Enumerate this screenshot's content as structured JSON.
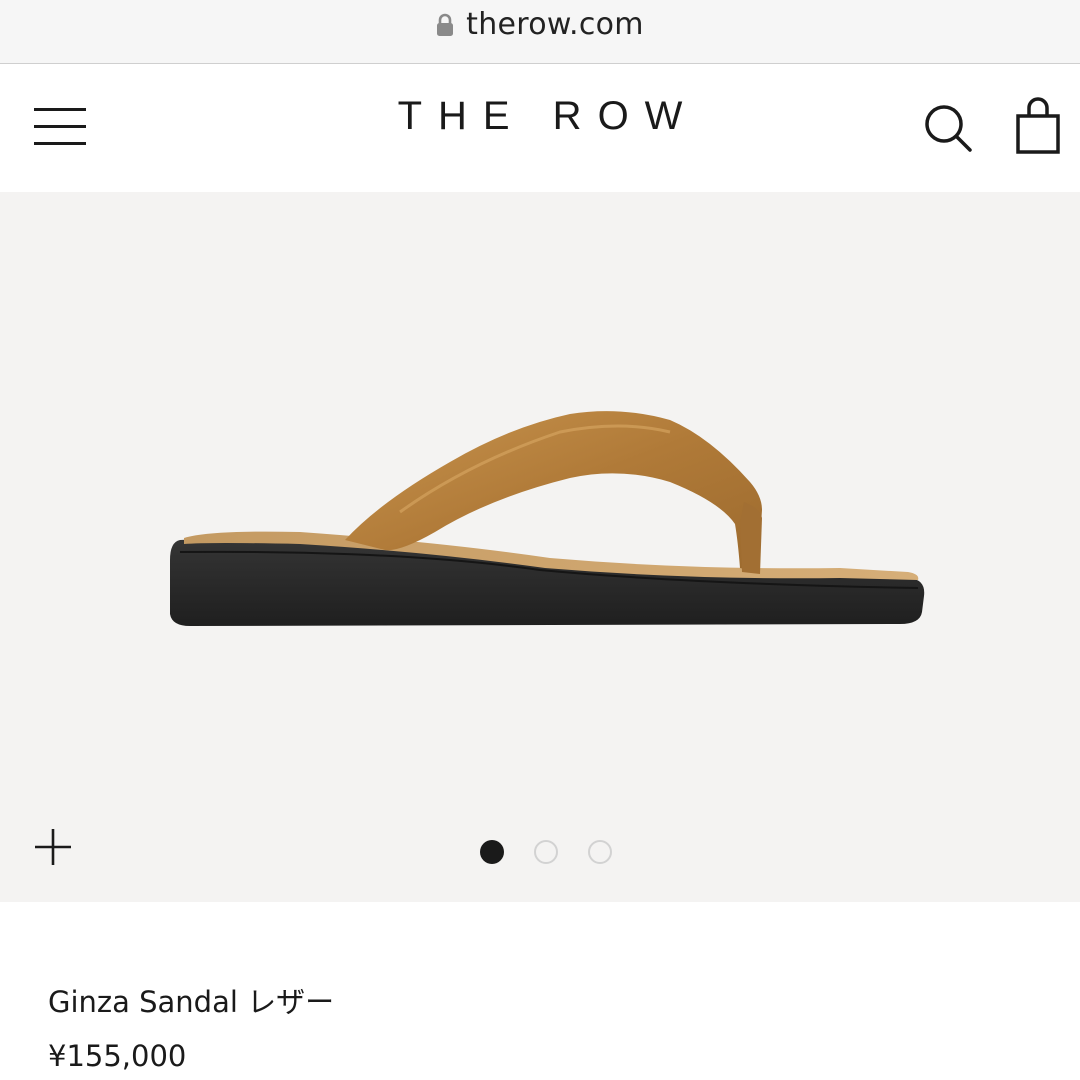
{
  "browser": {
    "url": "therow.com",
    "lock_icon": "lock-icon"
  },
  "header": {
    "brand": "THE ROW",
    "menu_icon": "hamburger-menu-icon",
    "search_icon": "search-icon",
    "bag_icon": "shopping-bag-icon"
  },
  "gallery": {
    "image_alt": "sandal-product-image",
    "zoom_icon": "plus-icon",
    "slide_count": 3,
    "active_slide": 1
  },
  "product": {
    "name": "Ginza Sandal レザー",
    "price": "¥155,000"
  },
  "colors": {
    "gallery_bg": "#f4f3f2",
    "strap": "#b7823f",
    "sole": "#2b2b2b"
  }
}
